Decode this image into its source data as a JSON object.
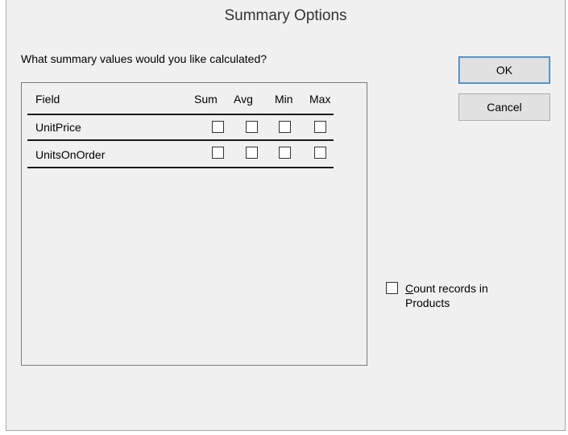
{
  "window": {
    "title": "Summary Options"
  },
  "prompt": "What summary values would you like calculated?",
  "columns": {
    "field": "Field",
    "sum": "Sum",
    "avg": "Avg",
    "min": "Min",
    "max": "Max"
  },
  "rows": [
    {
      "field": "UnitPrice",
      "sum": false,
      "avg": false,
      "min": false,
      "max": false
    },
    {
      "field": "UnitsOnOrder",
      "sum": false,
      "avg": false,
      "min": false,
      "max": false
    }
  ],
  "buttons": {
    "ok": "OK",
    "cancel": "Cancel"
  },
  "count_records": {
    "mnemonic": "C",
    "label_rest": "ount records in",
    "label_line2": "Products",
    "checked": false
  }
}
